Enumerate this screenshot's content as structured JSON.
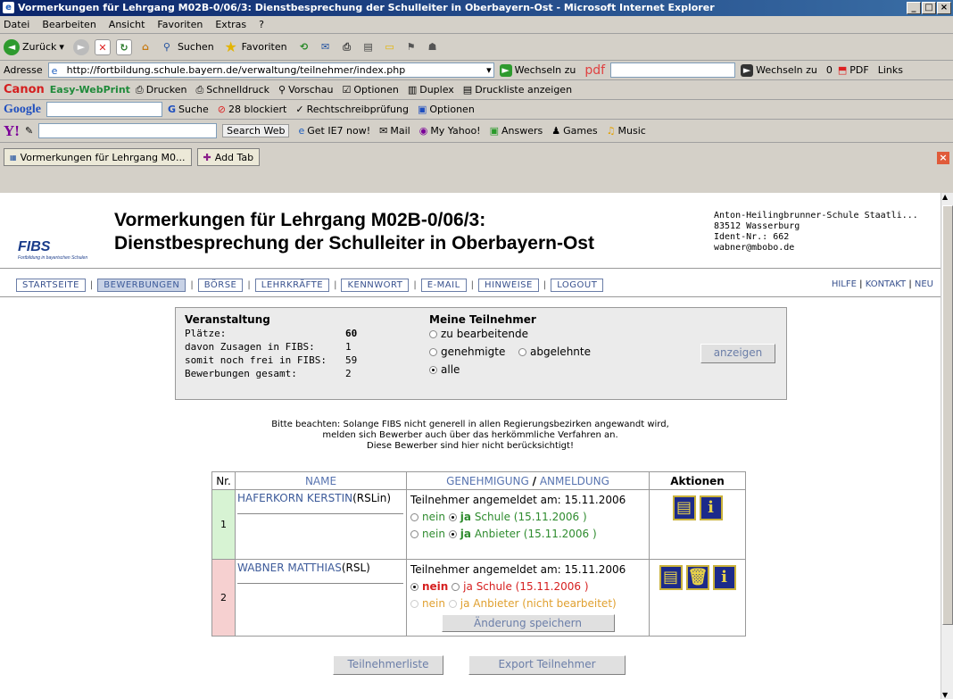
{
  "window": {
    "title": "Vormerkungen für Lehrgang M02B-0/06/3: Dienstbesprechung der Schulleiter in Oberbayern-Ost - Microsoft Internet Explorer",
    "controls": [
      "_",
      "□",
      "×"
    ]
  },
  "menu": [
    "Datei",
    "Bearbeiten",
    "Ansicht",
    "Favoriten",
    "Extras",
    "?"
  ],
  "toolbar": {
    "back": "Zurück",
    "search": "Suchen",
    "favorites": "Favoriten"
  },
  "address": {
    "label": "Adresse",
    "url": "http://fortbildung.schule.bayern.de/verwaltung/teilnehmer/index.php",
    "go": "Wechseln zu",
    "pdf_go": "Wechseln zu",
    "pdf_count": "0",
    "pdf": "PDF",
    "links": "Links"
  },
  "canon": {
    "brand": "Canon",
    "product": "Easy-WebPrint",
    "print": "Drucken",
    "quick": "Schnelldruck",
    "preview": "Vorschau",
    "options": "Optionen",
    "duplex": "Duplex",
    "list": "Druckliste anzeigen"
  },
  "google": {
    "brand": "Google",
    "search": "Suche",
    "blocked": "28 blockiert",
    "spell": "Rechtschreibprüfung",
    "options": "Optionen"
  },
  "yahoo": {
    "search_web": "Search Web",
    "ie7": "Get IE7 now!",
    "mail": "Mail",
    "my_yahoo": "My Yahoo!",
    "answers": "Answers",
    "games": "Games",
    "music": "Music"
  },
  "tabs": {
    "active": "Vormerkungen für Lehrgang M0...",
    "add": "Add Tab"
  },
  "site": {
    "logo": "FIBS",
    "logo_sub": "Fortbildung in bayerischen Schulen",
    "heading_line1": "Vormerkungen für Lehrgang M02B-0/06/3:",
    "heading_line2": "Dienstbesprechung der Schulleiter in Oberbayern-Ost",
    "school": [
      "Anton-Heilingbrunner-Schule Staatli...",
      "83512 Wasserburg",
      "Ident-Nr.: 662",
      "wabner@mbobo.de"
    ]
  },
  "nav": [
    "STARTSEITE",
    "BEWERBUNGEN",
    "BÖRSE",
    "LEHRKRÄFTE",
    "KENNWORT",
    "E-MAIL",
    "HINWEISE",
    "LOGOUT"
  ],
  "right_links": [
    "HILFE",
    "KONTAKT",
    "NEU"
  ],
  "event": {
    "title": "Veranstaltung",
    "rows": [
      {
        "label": "Plätze:",
        "value": "60"
      },
      {
        "label": "davon Zusagen in FIBS:",
        "value": "1"
      },
      {
        "label": "somit noch frei in FIBS:",
        "value": "59"
      },
      {
        "label": "Bewerbungen gesamt:",
        "value": "2"
      }
    ]
  },
  "filter": {
    "title": "Meine Teilnehmer",
    "options": [
      "zu bearbeitende",
      "genehmigte",
      "abgelehnte",
      "alle"
    ],
    "selected": "alle",
    "button": "anzeigen"
  },
  "note": [
    "Bitte beachten: Solange FIBS nicht generell in allen Regierungsbezirken angewandt wird,",
    "melden sich Bewerber auch über das herkömmliche Verfahren an.",
    "Diese Bewerber sind hier nicht berücksichtigt!"
  ],
  "table": {
    "headers": {
      "nr": "Nr.",
      "name": "NAME",
      "approval": "GENEHMIGUNG",
      "slash": "/",
      "registration": "ANMELDUNG",
      "actions": "Aktionen"
    },
    "rows": [
      {
        "nr": "1",
        "name": "HAFERKORN KERSTIN",
        "role": "(RSLin)",
        "registered": "Teilnehmer angemeldet am: 15.11.2006",
        "school_no": "nein",
        "school_yes": "ja",
        "school_text": "Schule (15.11.2006 )",
        "provider_no": "nein",
        "provider_yes": "ja",
        "provider_text": "Anbieter (15.11.2006 )"
      },
      {
        "nr": "2",
        "name": "WABNER MATTHIAS",
        "role": "(RSL)",
        "registered": "Teilnehmer angemeldet am: 15.11.2006",
        "school_no": "nein",
        "school_yes": "ja",
        "school_text": "Schule (15.11.2006 )",
        "provider_no": "nein",
        "provider_yes": "ja",
        "provider_text": "Anbieter (nicht bearbeitet)",
        "save": "Änderung speichern"
      }
    ]
  },
  "bottom_buttons": [
    "Teilnehmerliste",
    "Export Teilnehmer"
  ]
}
